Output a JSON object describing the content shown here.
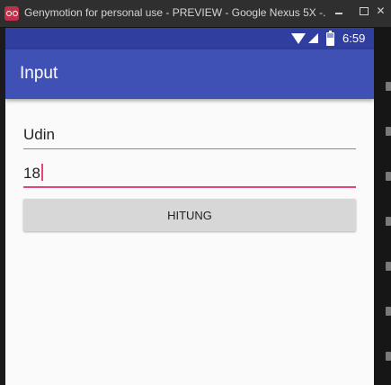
{
  "window": {
    "title": "Genymotion for personal use - PREVIEW - Google Nexus 5X -...",
    "close_glyph": "✕"
  },
  "statusbar": {
    "time": "6:59"
  },
  "appbar": {
    "title": "Input"
  },
  "form": {
    "name_value": "Udin",
    "age_value": "18",
    "submit_label": "HITUNG"
  },
  "colors": {
    "primary": "#3f51b5",
    "primary_dark": "#303f9f",
    "accent": "#e5457c"
  }
}
